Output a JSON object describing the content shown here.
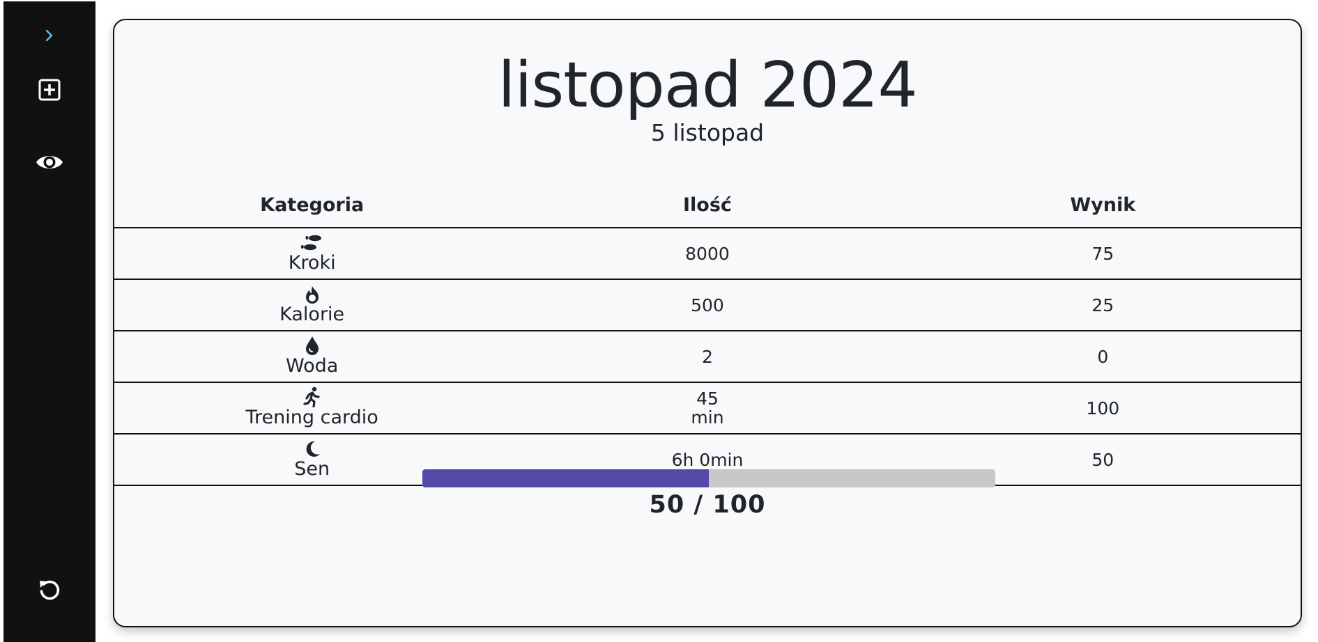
{
  "sidebar": {
    "expand_icon": "chevron-right-icon",
    "add_icon": "plus-square-icon",
    "view_icon": "eye-icon",
    "reset_icon": "undo-icon"
  },
  "header": {
    "month_title": "listopad 2024",
    "day_subtitle": "5 listopad"
  },
  "table": {
    "headers": [
      "Kategoria",
      "Ilość",
      "Wynik"
    ],
    "rows": [
      {
        "icon": "footprints-icon",
        "category": "Kroki",
        "amount": "8000",
        "amount_unit": "",
        "score": "75"
      },
      {
        "icon": "fire-icon",
        "category": "Kalorie",
        "amount": "500",
        "amount_unit": "",
        "score": "25"
      },
      {
        "icon": "water-drop-icon",
        "category": "Woda",
        "amount": "2",
        "amount_unit": "",
        "score": "0"
      },
      {
        "icon": "running-person-icon",
        "category": "Trening cardio",
        "amount": "45",
        "amount_unit": "min",
        "score": "100"
      },
      {
        "icon": "moon-icon",
        "category": "Sen",
        "amount": "6h 0min",
        "amount_unit": "",
        "score": "50"
      }
    ]
  },
  "summary": {
    "progress_fraction": 0.5,
    "score_text": "50 / 100"
  },
  "colors": {
    "sidebar_bg": "#111111",
    "accent": "#5bc0f5",
    "progress_fill": "#534aa8",
    "progress_track": "#c8c8c8",
    "card_bg": "#f8f9fa"
  }
}
